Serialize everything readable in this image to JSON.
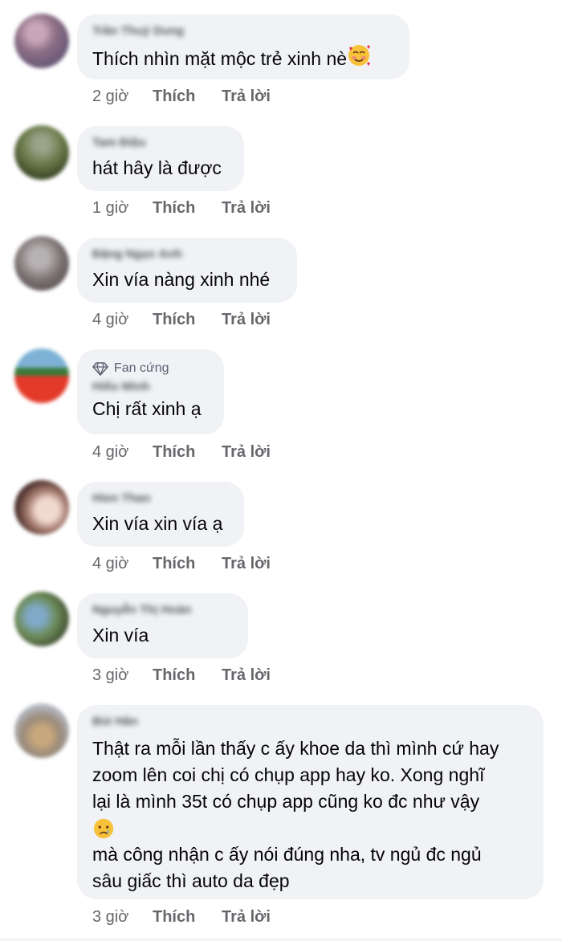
{
  "comments": [
    {
      "author": "Trần Thuỷ Dung",
      "text": "Thích nhìn mặt mộc trẻ xinh nè",
      "emoji": "smiling-face-with-hearts",
      "time": "2 giờ",
      "like_label": "Thích",
      "reply_label": "Trả lời"
    },
    {
      "author": "Tam Điệu",
      "text": "hát hây là được",
      "time": "1 giờ",
      "like_label": "Thích",
      "reply_label": "Trả lời"
    },
    {
      "author": "Đặng Ngọc Anh",
      "text": "Xin vía nàng xinh nhé",
      "time": "4 giờ",
      "like_label": "Thích",
      "reply_label": "Trả lời"
    },
    {
      "badge": "Fan cứng",
      "badge_icon": "diamond-icon",
      "author": "Hiếu Minh",
      "text": "Chị rất xinh ạ",
      "time": "4 giờ",
      "like_label": "Thích",
      "reply_label": "Trả lời"
    },
    {
      "author": "Hien Thao",
      "text": "Xin vía xin vía ạ",
      "time": "4 giờ",
      "like_label": "Thích",
      "reply_label": "Trả lời"
    },
    {
      "author": "Nguyễn Thị Hoàn",
      "text": "Xin vía",
      "time": "3 giờ",
      "like_label": "Thích",
      "reply_label": "Trả lời"
    },
    {
      "author": "Bùi Hân",
      "lines": [
        "Thật ra mỗi lần thấy c ấy khoe da thì mình cứ hay",
        "zoom lên coi chị có chụp app hay ko. Xong nghĩ",
        "lại là mình 35t có chụp app cũng ko đc như vậy",
        "mà công nhận c ấy nói đúng nha, tv ngủ đc ngủ",
        "sâu giấc thì auto da đẹp"
      ],
      "emoji": "crying-face",
      "time": "3 giờ",
      "like_label": "Thích",
      "reply_label": "Trả lời"
    }
  ],
  "colors": {
    "bubble": "#f0f2f5",
    "text": "#050505",
    "meta": "#65676b"
  }
}
